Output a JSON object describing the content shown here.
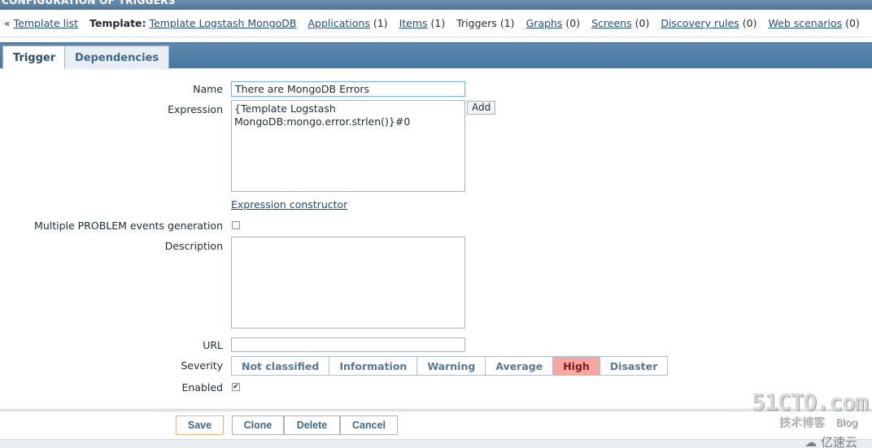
{
  "header": {
    "title": "CONFIGURATION OF TRIGGERS"
  },
  "nav": {
    "laquo": "«",
    "template_list": "Template list",
    "template_prefix": "Template:",
    "template_name": "Template Logstash MongoDB",
    "items": [
      {
        "label": "Applications",
        "count": "(1)",
        "link": true
      },
      {
        "label": "Items",
        "count": "(1)",
        "link": true
      },
      {
        "label": "Triggers",
        "count": "(1)",
        "link": false
      },
      {
        "label": "Graphs",
        "count": "(0)",
        "link": true
      },
      {
        "label": "Screens",
        "count": "(0)",
        "link": true
      },
      {
        "label": "Discovery rules",
        "count": "(0)",
        "link": true
      },
      {
        "label": "Web scenarios",
        "count": "(0)",
        "link": true
      }
    ]
  },
  "tabs": [
    {
      "label": "Trigger",
      "active": true
    },
    {
      "label": "Dependencies",
      "active": false
    }
  ],
  "form": {
    "name_label": "Name",
    "name_value": "There are MongoDB Errors",
    "expression_label": "Expression",
    "expression_value": "{Template Logstash MongoDB:mongo.error.strlen()}#0",
    "add_button": "Add",
    "expression_constructor": "Expression constructor",
    "multiple_label": "Multiple PROBLEM events generation",
    "multiple_checked": false,
    "description_label": "Description",
    "description_value": "",
    "url_label": "URL",
    "url_value": "",
    "severity_label": "Severity",
    "severity_options": [
      "Not classified",
      "Information",
      "Warning",
      "Average",
      "High",
      "Disaster"
    ],
    "severity_selected": "High",
    "enabled_label": "Enabled",
    "enabled_checked": true
  },
  "footer": {
    "save": "Save",
    "clone": "Clone",
    "delete": "Delete",
    "cancel": "Cancel"
  },
  "watermark": {
    "line1": "51CTO.com",
    "line2": "技术博客",
    "blog": "Blog",
    "line3": "亿速云"
  },
  "colors": {
    "accent_blue": "#4a78a2",
    "severity_high": "#f7a6a1",
    "link": "#1f4d80"
  }
}
